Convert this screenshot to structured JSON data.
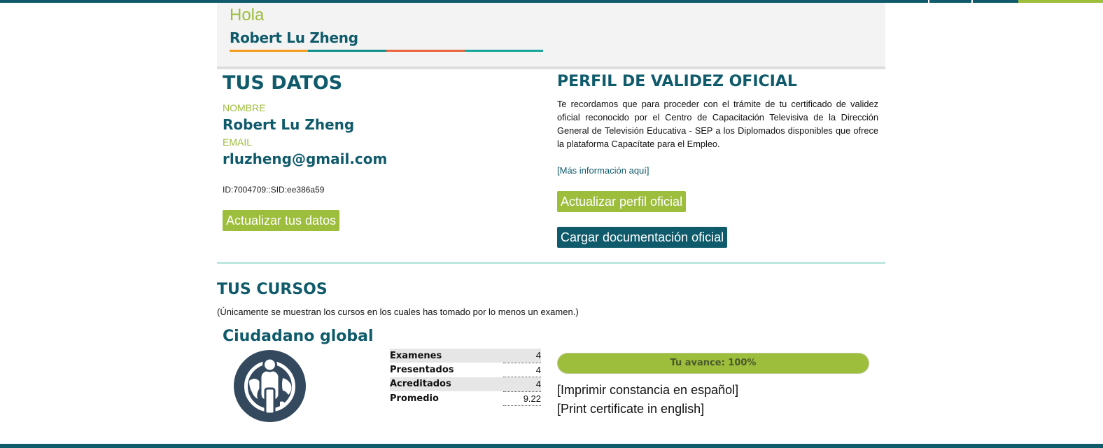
{
  "colors": {
    "brand_teal": "#0f5a6b",
    "brand_green": "#9dbd3c",
    "stripe_orange": "#f39c1f",
    "stripe_teal": "#0f8f8a",
    "stripe_red": "#e8643c",
    "stripe_aqua": "#17a59a"
  },
  "greeting": {
    "hola": "Hola",
    "name": "Robert Lu Zheng"
  },
  "datos": {
    "title": "TUS DATOS",
    "nombre_label": "NOMBRE",
    "nombre_value": "Robert Lu Zheng",
    "email_label": "EMAIL",
    "email_value": "rluzheng@gmail.com",
    "id_text": "ID:7004709::SID:ee386a59",
    "update_button": "Actualizar tus datos"
  },
  "perfil": {
    "title": "PERFIL DE VALIDEZ OFICIAL",
    "description": "Te recordamos que para proceder con el trámite de tu certificado de validez oficial reconocido por el Centro de Capacitación Televisiva de la Dirección General de Televisión Educativa - SEP a los Diplomados disponibles que ofrece la plataforma Capacítate para el Empleo.",
    "more_info_link": "[Más información aquí]",
    "update_button": "Actualizar perfil oficial",
    "upload_button": "Cargar documentación oficial"
  },
  "cursos": {
    "title": "TUS CURSOS",
    "note": "(Únicamente se muestran los cursos en los cuales has tomado por lo menos un examen.)",
    "items": [
      {
        "name": "Ciudadano global",
        "icon": "global-citizen-icon",
        "stats": [
          {
            "label": "Examenes",
            "value": "4"
          },
          {
            "label": "Presentados",
            "value": "4"
          },
          {
            "label": "Acreditados",
            "value": "4"
          },
          {
            "label": "Promedio",
            "value": "9.22"
          }
        ],
        "progress_label": "Tu avance: 100%",
        "progress_fraction": 1.0,
        "print_es": "[Imprimir constancia en español]",
        "print_en": "[Print certificate in english]"
      }
    ]
  }
}
